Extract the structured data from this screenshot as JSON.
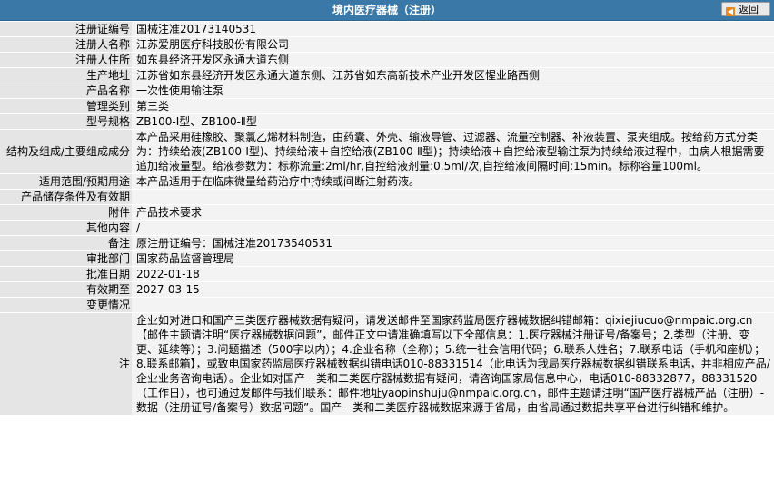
{
  "header": {
    "title": "境内医疗器械（注册）",
    "back_label": "返回"
  },
  "rows": [
    {
      "label": "注册证编号",
      "value": "国械注准20173140531"
    },
    {
      "label": "注册人名称",
      "value": "江苏爱朋医疗科技股份有限公司"
    },
    {
      "label": "注册人住所",
      "value": "如东县经济开发区永通大道东侧"
    },
    {
      "label": "生产地址",
      "value": "江苏省如东县经济开发区永通大道东侧、江苏省如东高新技术产业开发区惺业路西侧"
    },
    {
      "label": "产品名称",
      "value": "一次性使用输注泵"
    },
    {
      "label": "管理类别",
      "value": "第三类"
    },
    {
      "label": "型号规格",
      "value": "ZB100-Ⅰ型、ZB100-Ⅱ型"
    },
    {
      "label": "结构及组成/主要组成成分",
      "value": "本产品采用硅橡胶、聚氯乙烯材料制造，由药囊、外壳、输液导管、过滤器、流量控制器、补液装置、泵夹组成。按给药方式分类为：持续给液(ZB100-Ⅰ型)、持续给液＋自控给液(ZB100-Ⅱ型)；持续给液＋自控给液型输注泵为持续给液过程中，由病人根据需要追加给液量型。给液参数为：标称流量:2ml/hr,自控给液剂量:0.5ml/次,自控给液间隔时间:15min。标称容量100ml。"
    },
    {
      "label": "适用范围/预期用途",
      "value": "本产品适用于在临床微量给药治疗中持续或间断注射药液。"
    },
    {
      "label": "产品储存条件及有效期",
      "value": ""
    },
    {
      "label": "附件",
      "value": "产品技术要求"
    },
    {
      "label": "其他内容",
      "value": "/"
    },
    {
      "label": "备注",
      "value": "原注册证编号：国械注准20173540531"
    },
    {
      "label": "审批部门",
      "value": "国家药品监督管理局"
    },
    {
      "label": "批准日期",
      "value": "2022-01-18"
    },
    {
      "label": "有效期至",
      "value": "2027-03-15"
    },
    {
      "label": "变更情况",
      "value": ""
    }
  ],
  "note": {
    "label": "注",
    "text": "企业如对进口和国产三类医疗器械数据有疑问，请发送邮件至国家药监局医疗器械数据纠错邮箱：qixiejiucuo@nmpaic.org.cn【邮件主题请注明“医疗器械数据问题”，邮件正文中请准确填写以下全部信息：1.医疗器械注册证号/备案号；2.类型（注册、变更、延续等）；3.问题描述（500字以内）；4.企业名称（全称）；5.统一社会信用代码；6.联系人姓名；7.联系电话（手机和座机）；8.联系邮箱】，或致电国家药监局医疗器械数据纠错电话010-88331514（此电话为我局医疗器械数据纠错联系电话，并非相应产品/企业业务咨询电话）。企业如对国产一类和二类医疗器械数据有疑问，请咨询国家局信息中心，电话010-88332877，88331520（工作日），也可通过发邮件与我们联系：邮件地址yaopinshuju@nmpaic.org.cn，邮件主题请注明“国产医疗器械产品（注册）-数据（注册证号/备案号）数据问题”。国产一类和二类医疗器械数据来源于省局，由省局通过数据共享平台进行纠错和维护。"
  }
}
